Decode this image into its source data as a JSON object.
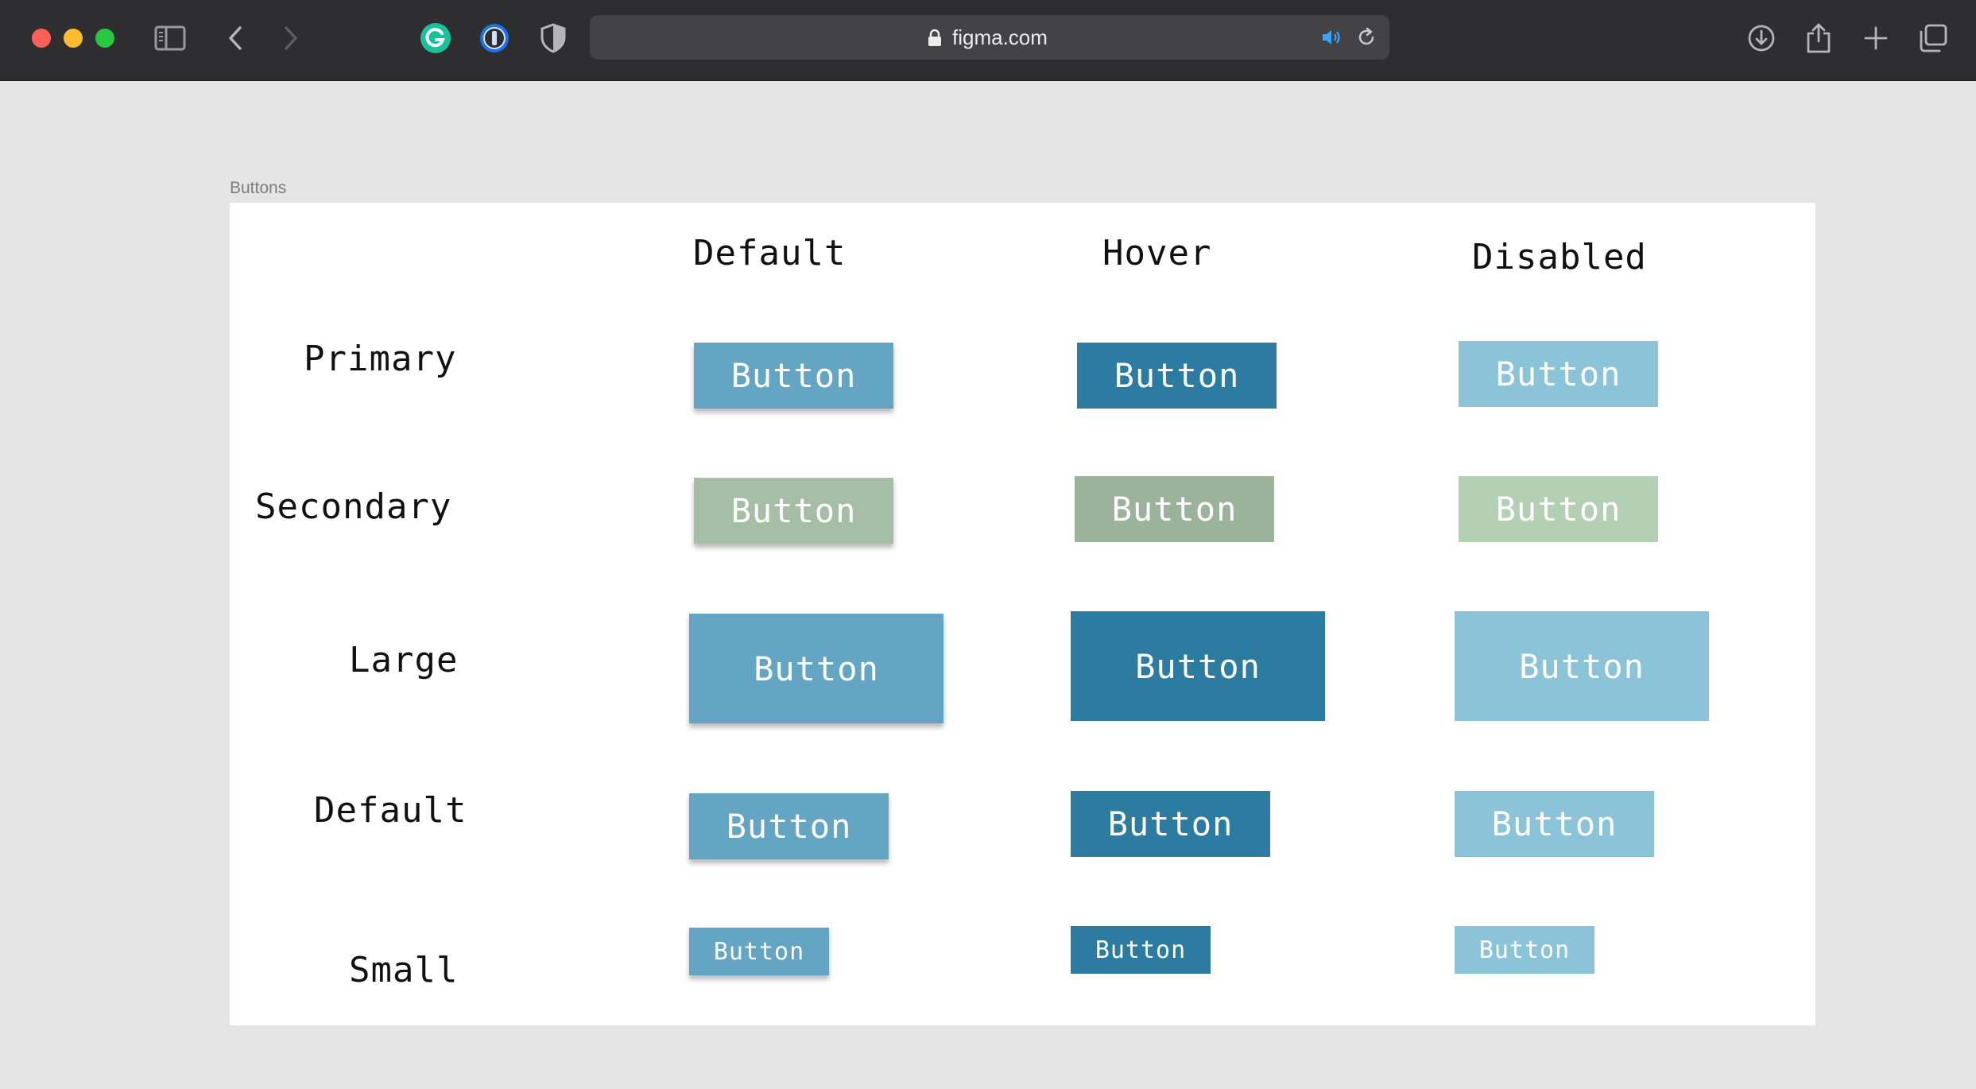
{
  "browser": {
    "url": "figma.com",
    "icons": {
      "sidebar": "sidebar-icon",
      "back": "chevron-left-icon",
      "forward": "chevron-right-icon",
      "grammarly": "grammarly-icon",
      "password_manager": "1password-icon",
      "privacy": "shield-icon",
      "lock": "lock-icon",
      "audio": "speaker-icon",
      "reload": "reload-icon",
      "downloads": "download-icon",
      "share": "share-icon",
      "new_tab": "plus-icon",
      "tabs_overview": "tabs-icon"
    }
  },
  "frame": {
    "label": "Buttons"
  },
  "columns": [
    "Default",
    "Hover",
    "Disabled"
  ],
  "rows": [
    "Primary",
    "Secondary",
    "Large",
    "Default",
    "Small"
  ],
  "button_label": "Button",
  "colors": {
    "primary_default": "#64a5c3",
    "primary_hover": "#2c7ca2",
    "primary_disabled": "#8bc3d8",
    "secondary_default": "#a6bea6",
    "secondary_hover": "#9bb29b",
    "secondary_disabled": "#b4d0b4",
    "button_text": "#ffffff"
  },
  "buttons": [
    {
      "row": "Primary",
      "state": "Default",
      "label": "Button"
    },
    {
      "row": "Primary",
      "state": "Hover",
      "label": "Button"
    },
    {
      "row": "Primary",
      "state": "Disabled",
      "label": "Button"
    },
    {
      "row": "Secondary",
      "state": "Default",
      "label": "Button"
    },
    {
      "row": "Secondary",
      "state": "Hover",
      "label": "Button"
    },
    {
      "row": "Secondary",
      "state": "Disabled",
      "label": "Button"
    },
    {
      "row": "Large",
      "state": "Default",
      "label": "Button"
    },
    {
      "row": "Large",
      "state": "Hover",
      "label": "Button"
    },
    {
      "row": "Large",
      "state": "Disabled",
      "label": "Button"
    },
    {
      "row": "Default",
      "state": "Default",
      "label": "Button"
    },
    {
      "row": "Default",
      "state": "Hover",
      "label": "Button"
    },
    {
      "row": "Default",
      "state": "Disabled",
      "label": "Button"
    },
    {
      "row": "Small",
      "state": "Default",
      "label": "Button"
    },
    {
      "row": "Small",
      "state": "Hover",
      "label": "Button"
    },
    {
      "row": "Small",
      "state": "Disabled",
      "label": "Button"
    }
  ]
}
